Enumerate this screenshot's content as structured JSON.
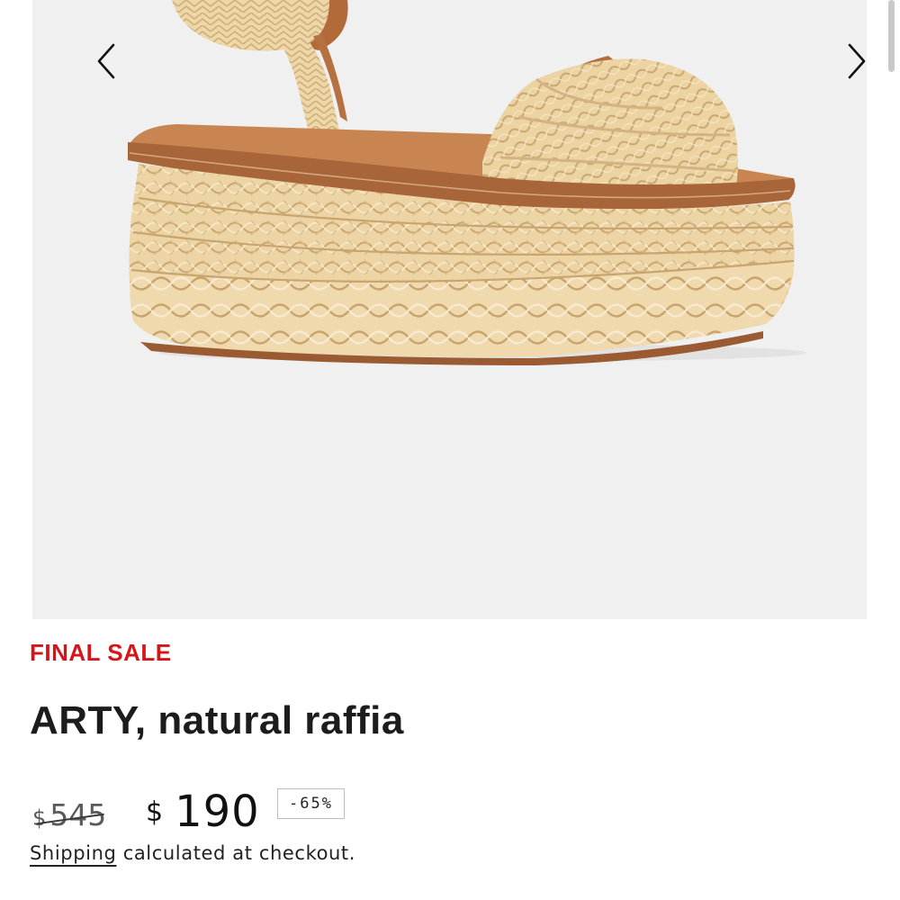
{
  "gallery": {
    "image_alt": "natural raffia flatform sandal",
    "prev_icon": "chevron-left-icon",
    "next_icon": "chevron-right-icon"
  },
  "product": {
    "badge": "FINAL SALE",
    "title": "ARTY, natural raffia"
  },
  "pricing": {
    "currency": "$",
    "original_price": "545",
    "sale_price": "190",
    "discount": "-65%"
  },
  "shipping": {
    "link_text": "Shipping",
    "rest_text": " calculated at checkout."
  },
  "colors": {
    "sale_red": "#d6151b",
    "gallery_bg": "#f0f0f0",
    "raffia": "#ecd3a2",
    "leather": "#b8754a"
  }
}
